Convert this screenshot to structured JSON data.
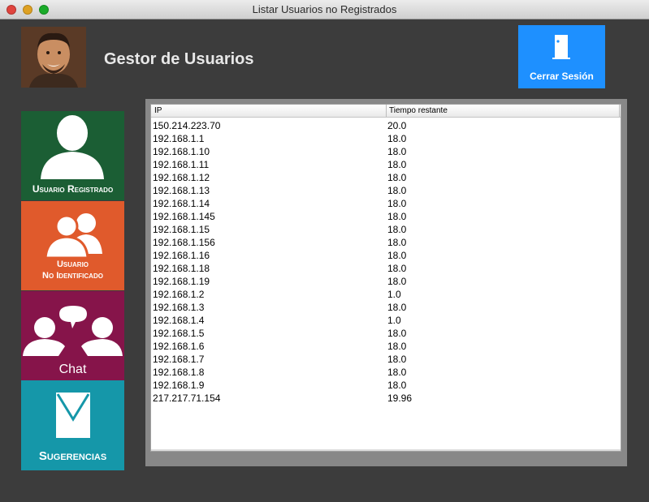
{
  "window": {
    "title": "Listar Usuarios no Registrados"
  },
  "header": {
    "app_title": "Gestor de Usuarios",
    "avatar_icon": "user-photo",
    "logout_label": "Cerrar Sesión",
    "logout_icon": "door-icon"
  },
  "sidebar": {
    "items": [
      {
        "label": "Usuario Registrado",
        "icon": "user-icon",
        "color": "#1b5e34"
      },
      {
        "label": "Usuario",
        "label2": "No Identificado",
        "icon": "users-icon",
        "color": "#e05a2c"
      },
      {
        "label": "Chat",
        "icon": "chat-icon",
        "color": "#86144a"
      },
      {
        "label": "Sugerencias",
        "icon": "envelope-icon",
        "color": "#1597a9"
      }
    ]
  },
  "table": {
    "columns": [
      "IP",
      "Tiempo restante"
    ],
    "rows": [
      [
        "150.214.223.70",
        "20.0"
      ],
      [
        "192.168.1.1",
        "18.0"
      ],
      [
        "192.168.1.10",
        "18.0"
      ],
      [
        "192.168.1.11",
        "18.0"
      ],
      [
        "192.168.1.12",
        "18.0"
      ],
      [
        "192.168.1.13",
        "18.0"
      ],
      [
        "192.168.1.14",
        "18.0"
      ],
      [
        "192.168.1.145",
        "18.0"
      ],
      [
        "192.168.1.15",
        "18.0"
      ],
      [
        "192.168.1.156",
        "18.0"
      ],
      [
        "192.168.1.16",
        "18.0"
      ],
      [
        "192.168.1.18",
        "18.0"
      ],
      [
        "192.168.1.19",
        "18.0"
      ],
      [
        "192.168.1.2",
        "1.0"
      ],
      [
        "192.168.1.3",
        "18.0"
      ],
      [
        "192.168.1.4",
        "1.0"
      ],
      [
        "192.168.1.5",
        "18.0"
      ],
      [
        "192.168.1.6",
        "18.0"
      ],
      [
        "192.168.1.7",
        "18.0"
      ],
      [
        "192.168.1.8",
        "18.0"
      ],
      [
        "192.168.1.9",
        "18.0"
      ],
      [
        "217.217.71.154",
        "19.96"
      ]
    ]
  },
  "colors": {
    "background": "#3c3c3c",
    "logout": "#1e90ff"
  }
}
